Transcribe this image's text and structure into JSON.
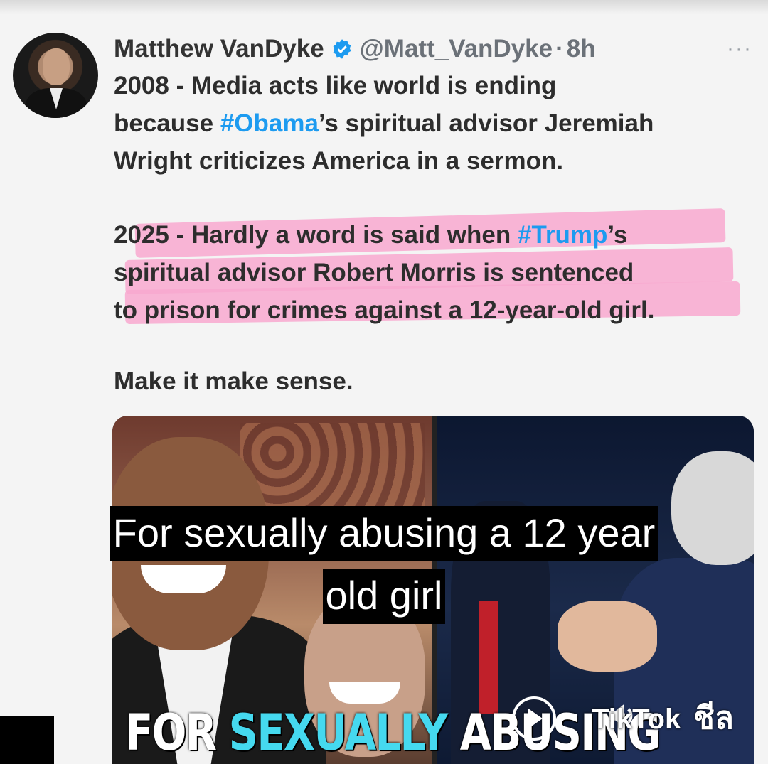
{
  "tweet": {
    "author_name": "Matthew VanDyke",
    "handle": "@Matt_VanDyke",
    "separator": "·",
    "time": "8h",
    "more": "···",
    "paragraph1": {
      "line1": "2008 - Media acts like world is ending",
      "line2_pre": "because ",
      "line2_hashtag": "#Obama",
      "line2_post": "’s spiritual advisor Jeremiah",
      "line3": "Wright criticizes America in a sermon."
    },
    "paragraph2": {
      "line1_pre": "2025 - Hardly a word is said when ",
      "line1_hashtag": "#Trump",
      "line1_post": "’s",
      "line2": "spiritual advisor Robert Morris is sentenced",
      "line3": "to prison for crimes against a 12-year-old girl."
    },
    "paragraph3": "Make it make sense."
  },
  "caption": {
    "line1": "For sexually abusing a 12 year",
    "line2": "old girl"
  },
  "banner": {
    "part1": "FOR ",
    "part2": "SEXUALLY",
    "part3": " ABUSING"
  },
  "overlay": {
    "tiktok": "TikTok",
    "thai": "ชีล"
  },
  "icons": [
    "verified-badge-icon",
    "more-icon",
    "play-icon",
    "sound-icon",
    "tiktok-logo-icon"
  ],
  "colors": {
    "hashtag": "#1d9bf0",
    "highlight": "#f8a8cf",
    "verified": "#1d9bf0",
    "banner_accent": "#45d9ef"
  }
}
